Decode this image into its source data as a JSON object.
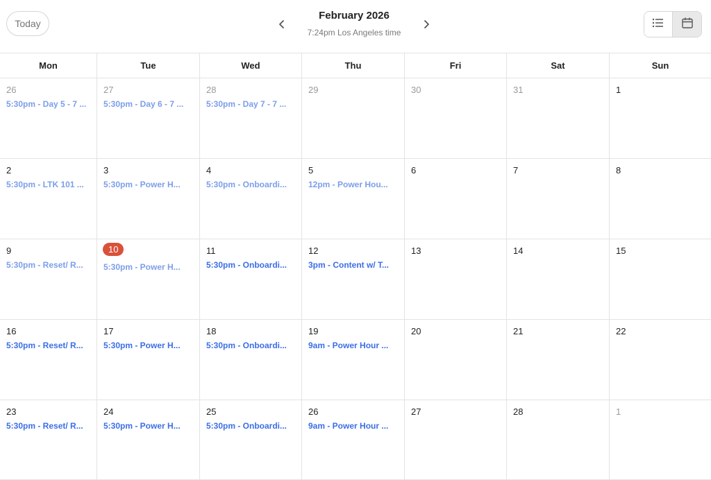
{
  "header": {
    "today_label": "Today",
    "title": "February 2026",
    "subtitle": "7:24pm Los Angeles time",
    "icons": {
      "prev": "chevron-left-icon",
      "next": "chevron-right-icon",
      "list_view": "list-icon",
      "calendar_view": "calendar-icon"
    }
  },
  "colors": {
    "accent": "#3b6ee6",
    "past_event": "#7c9ee9",
    "today_badge": "#d9513a"
  },
  "weekdays": [
    "Mon",
    "Tue",
    "Wed",
    "Thu",
    "Fri",
    "Sat",
    "Sun"
  ],
  "weeks": [
    [
      {
        "day": "26",
        "out": true,
        "event": "5:30pm - Day 5 - 7 ...",
        "past": true
      },
      {
        "day": "27",
        "out": true,
        "event": "5:30pm - Day 6 - 7 ...",
        "past": true
      },
      {
        "day": "28",
        "out": true,
        "event": "5:30pm - Day 7 - 7 ...",
        "past": true
      },
      {
        "day": "29",
        "out": true,
        "event": "",
        "past": false
      },
      {
        "day": "30",
        "out": true,
        "event": "",
        "past": false
      },
      {
        "day": "31",
        "out": true,
        "event": "",
        "past": false
      },
      {
        "day": "1",
        "out": false,
        "event": "",
        "past": false
      }
    ],
    [
      {
        "day": "2",
        "out": false,
        "event": "5:30pm - LTK 101 ...",
        "past": true
      },
      {
        "day": "3",
        "out": false,
        "event": "5:30pm - Power H...",
        "past": true
      },
      {
        "day": "4",
        "out": false,
        "event": "5:30pm - Onboardi...",
        "past": true
      },
      {
        "day": "5",
        "out": false,
        "event": "12pm - Power Hou...",
        "past": true
      },
      {
        "day": "6",
        "out": false,
        "event": "",
        "past": false
      },
      {
        "day": "7",
        "out": false,
        "event": "",
        "past": false
      },
      {
        "day": "8",
        "out": false,
        "event": "",
        "past": false
      }
    ],
    [
      {
        "day": "9",
        "out": false,
        "event": "5:30pm - Reset/ R...",
        "past": true
      },
      {
        "day": "10",
        "out": false,
        "today": true,
        "event": "5:30pm - Power H...",
        "past": true
      },
      {
        "day": "11",
        "out": false,
        "event": "5:30pm - Onboardi...",
        "past": false
      },
      {
        "day": "12",
        "out": false,
        "event": "3pm - Content w/ T...",
        "past": false
      },
      {
        "day": "13",
        "out": false,
        "event": "",
        "past": false
      },
      {
        "day": "14",
        "out": false,
        "event": "",
        "past": false
      },
      {
        "day": "15",
        "out": false,
        "event": "",
        "past": false
      }
    ],
    [
      {
        "day": "16",
        "out": false,
        "event": "5:30pm - Reset/ R...",
        "past": false
      },
      {
        "day": "17",
        "out": false,
        "event": "5:30pm - Power H...",
        "past": false
      },
      {
        "day": "18",
        "out": false,
        "event": "5:30pm - Onboardi...",
        "past": false
      },
      {
        "day": "19",
        "out": false,
        "event": "9am - Power Hour ...",
        "past": false
      },
      {
        "day": "20",
        "out": false,
        "event": "",
        "past": false
      },
      {
        "day": "21",
        "out": false,
        "event": "",
        "past": false
      },
      {
        "day": "22",
        "out": false,
        "event": "",
        "past": false
      }
    ],
    [
      {
        "day": "23",
        "out": false,
        "event": "5:30pm - Reset/ R...",
        "past": false
      },
      {
        "day": "24",
        "out": false,
        "event": "5:30pm - Power H...",
        "past": false
      },
      {
        "day": "25",
        "out": false,
        "event": "5:30pm - Onboardi...",
        "past": false
      },
      {
        "day": "26",
        "out": false,
        "event": "9am - Power Hour ...",
        "past": false
      },
      {
        "day": "27",
        "out": false,
        "event": "",
        "past": false
      },
      {
        "day": "28",
        "out": false,
        "event": "",
        "past": false
      },
      {
        "day": "1",
        "out": true,
        "event": "",
        "past": false
      }
    ]
  ]
}
